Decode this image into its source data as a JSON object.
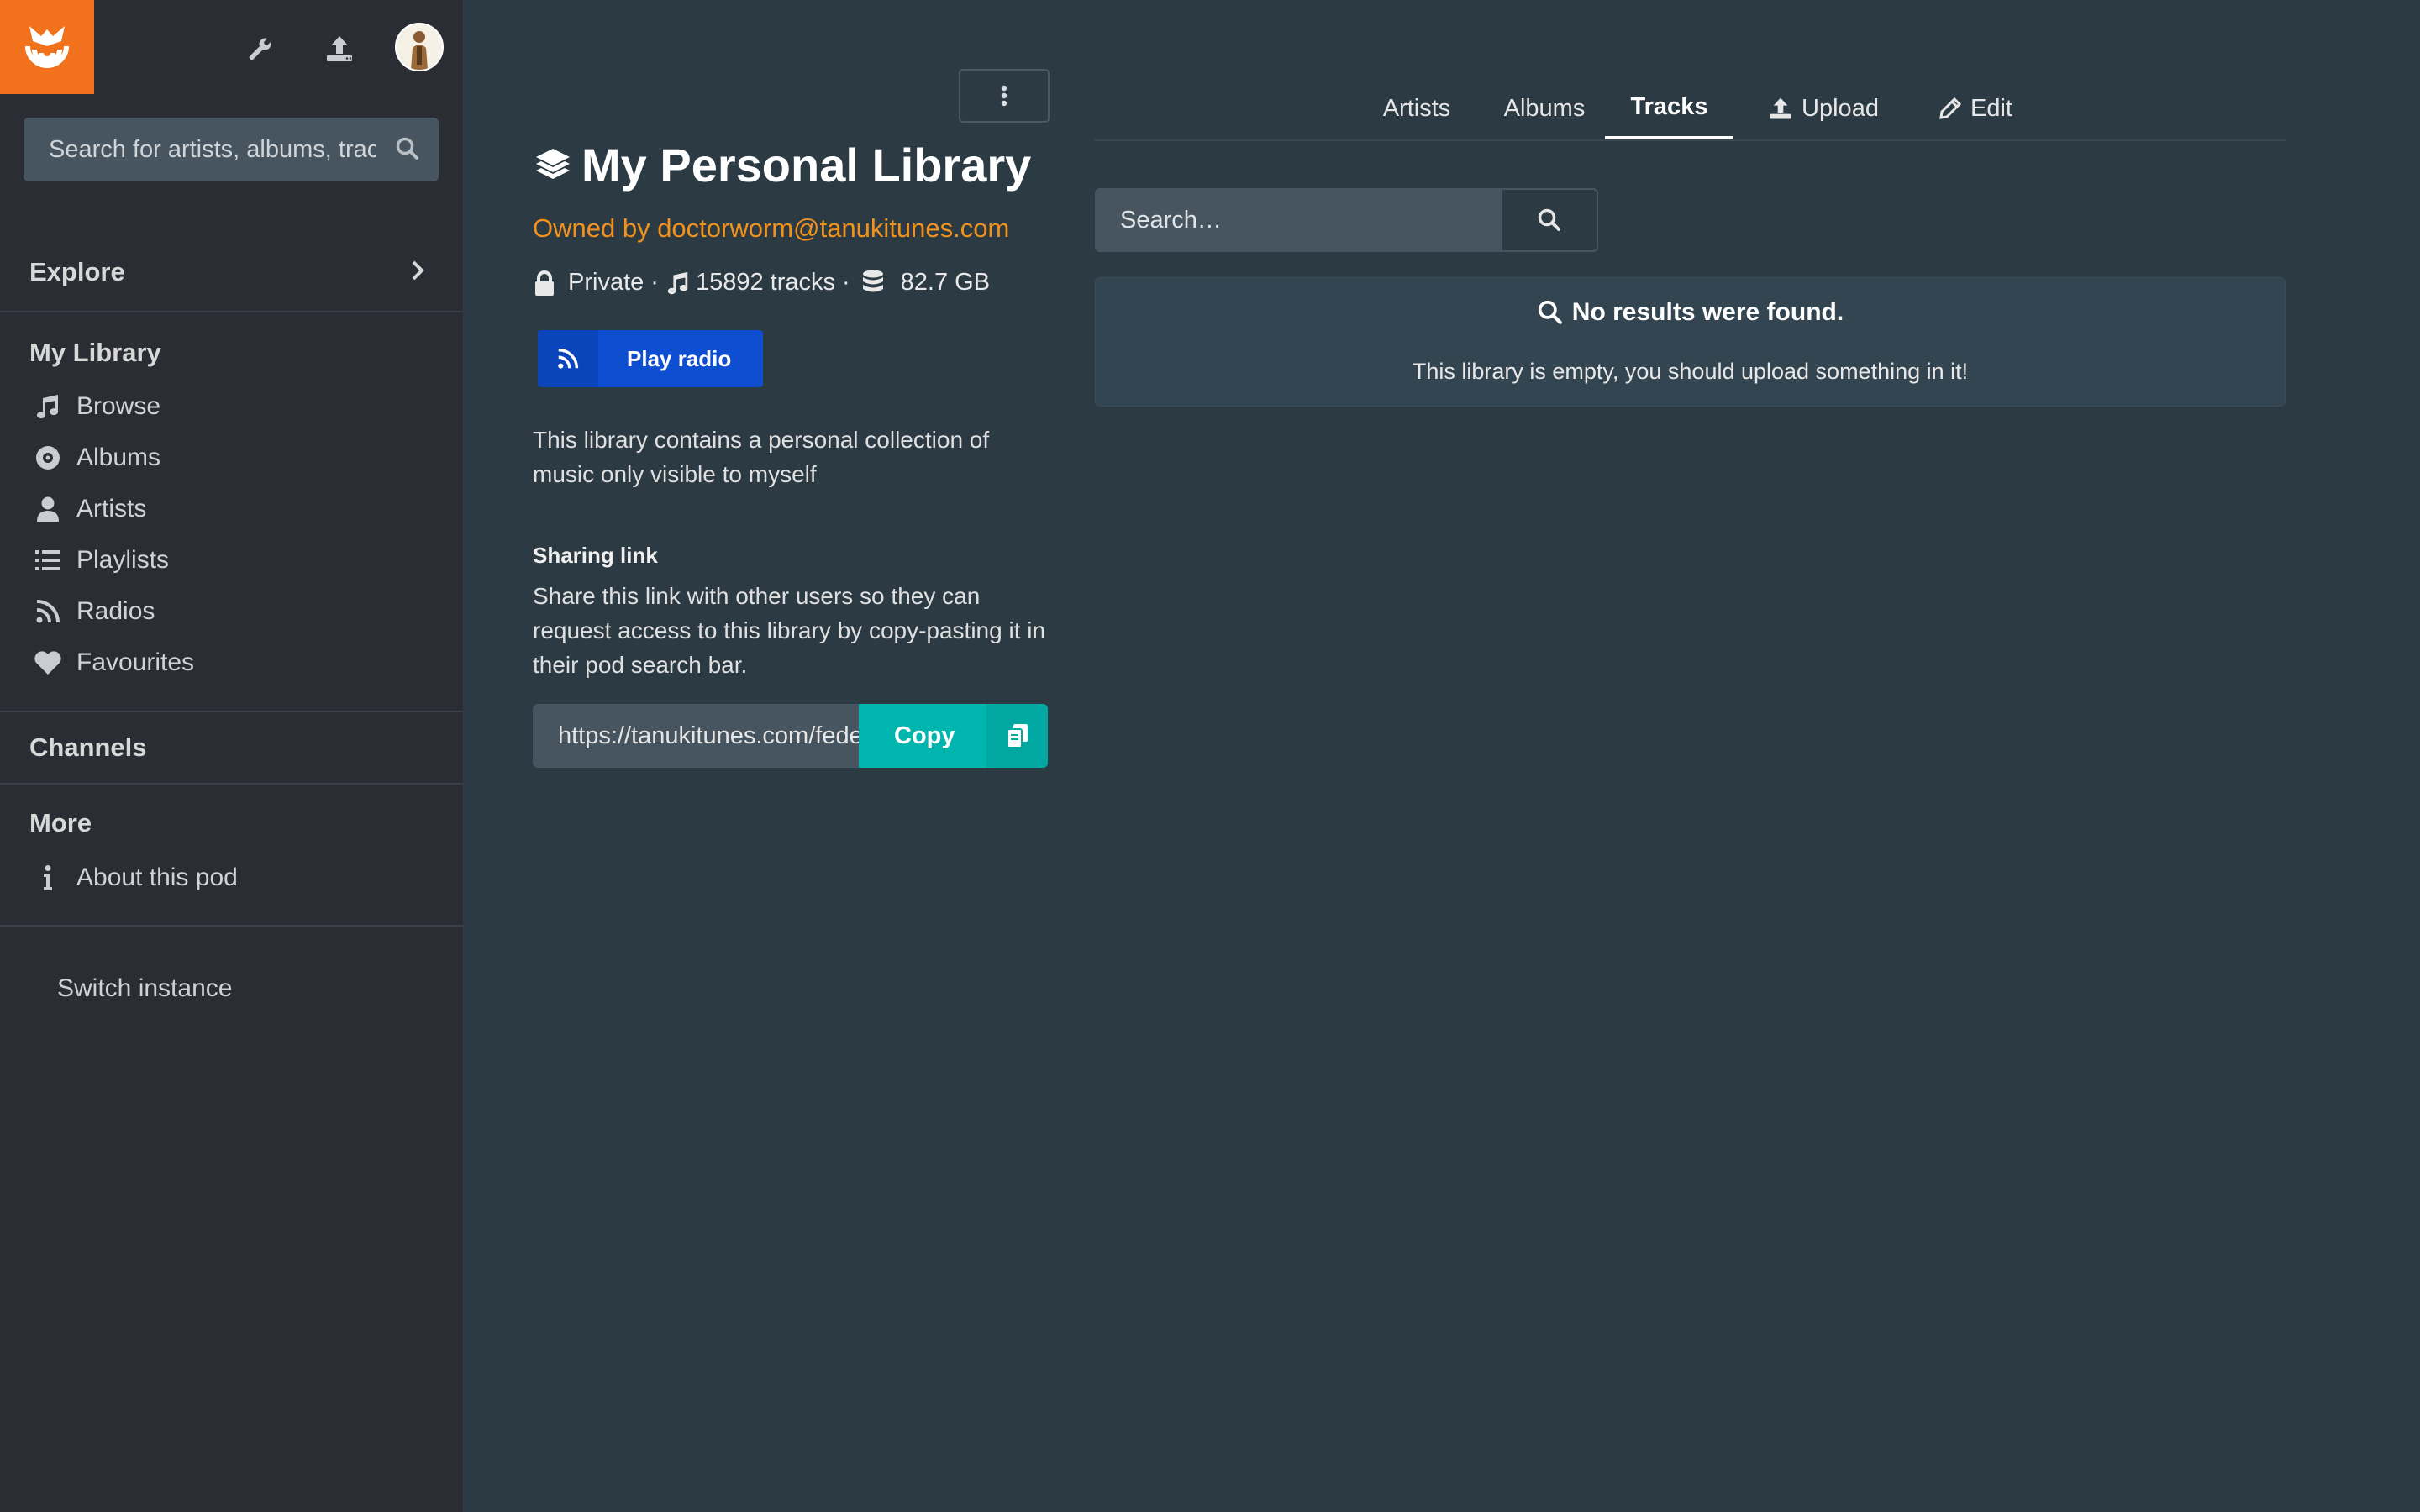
{
  "sidebar": {
    "search_placeholder": "Search for artists, albums, tracks…",
    "explore": "Explore",
    "my_library": "My Library",
    "items": [
      {
        "label": "Browse",
        "icon": "music-note-icon"
      },
      {
        "label": "Albums",
        "icon": "disc-icon"
      },
      {
        "label": "Artists",
        "icon": "user-icon"
      },
      {
        "label": "Playlists",
        "icon": "list-icon"
      },
      {
        "label": "Radios",
        "icon": "rss-icon"
      },
      {
        "label": "Favourites",
        "icon": "heart-icon"
      }
    ],
    "channels": "Channels",
    "more": "More",
    "about": "About this pod",
    "switch_instance": "Switch instance"
  },
  "library": {
    "title": "My Personal Library",
    "owner": "Owned by doctorworm@tanukitunes.com",
    "privacy": "Private",
    "tracks": "15892 tracks",
    "size": "82.7 GB",
    "separator": "·",
    "play_radio": "Play radio",
    "description": "This library contains a personal collection of music only visible to myself",
    "sharing_head": "Sharing link",
    "sharing_desc": "Share this link with other users so they can request access to this library by copy-pasting it in their pod search bar.",
    "sharing_url": "https://tanukitunes.com/federation/music/libraries/",
    "copy_label": "Copy"
  },
  "tabs": [
    {
      "label": "Artists"
    },
    {
      "label": "Albums"
    },
    {
      "label": "Tracks",
      "active": true
    },
    {
      "label": "Upload"
    },
    {
      "label": "Edit"
    }
  ],
  "search": {
    "placeholder": "Search…"
  },
  "empty": {
    "heading": "No results were found.",
    "message": "This library is empty, you should upload something in it!"
  },
  "colors": {
    "accent_orange": "#f2711c",
    "owner_orange": "#f2921c",
    "play_blue": "#0e4fd1",
    "copy_teal": "#00b5ad",
    "bg": "#2c3a44",
    "sidebar_bg": "#2a2d33"
  }
}
